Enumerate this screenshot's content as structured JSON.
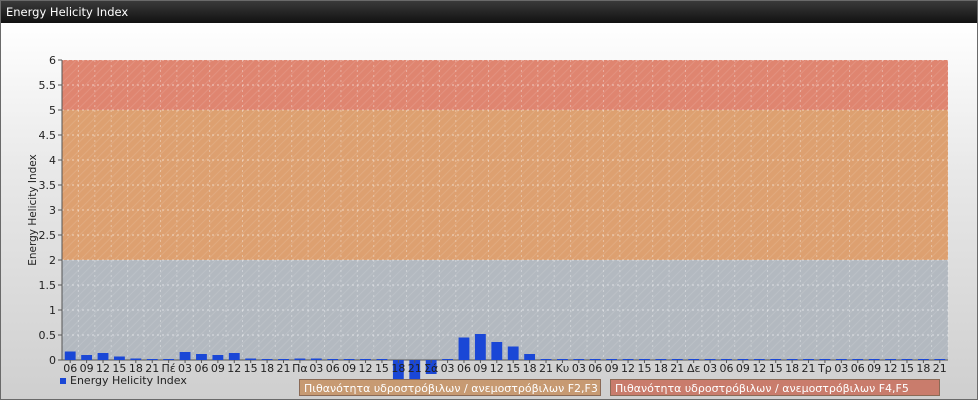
{
  "window": {
    "title": "Energy Helicity Index"
  },
  "legend": {
    "label": "Energy Helicity Index"
  },
  "bands": {
    "f23_label": "Πιθανότητα υδροστρόβιλων / ανεμοστρόβιλων F2,F3",
    "f45_label": "Πιθανότητα υδροστρόβιλων / ανεμοστρόβιλων F4,F5"
  },
  "colors": {
    "bar": "#1a47d6",
    "band_low": "#b3b9c0",
    "band_mid": "#dda070",
    "band_high": "#df8570"
  },
  "chart_data": {
    "type": "bar",
    "ylabel": "Energy Helicity Index",
    "ylim": [
      0,
      6
    ],
    "yticks": [
      "0",
      "0.5",
      "1",
      "1.5",
      "2",
      "2.5",
      "3",
      "3.5",
      "4",
      "4.5",
      "5",
      "5.5",
      "6"
    ],
    "shaded_bands": [
      {
        "from": 0,
        "to": 2,
        "color": "#b3b9c0"
      },
      {
        "from": 2,
        "to": 5,
        "color": "#dda070"
      },
      {
        "from": 5,
        "to": 6,
        "color": "#df8570"
      }
    ],
    "categories": [
      "06",
      "09",
      "12",
      "15",
      "18",
      "21",
      "Πέ",
      "03",
      "06",
      "09",
      "12",
      "15",
      "18",
      "21",
      "Πα",
      "03",
      "06",
      "09",
      "12",
      "15",
      "18",
      "21",
      "Σά",
      "03",
      "06",
      "09",
      "12",
      "15",
      "18",
      "21",
      "Κυ",
      "03",
      "06",
      "09",
      "12",
      "15",
      "18",
      "21",
      "Δε",
      "03",
      "06",
      "09",
      "12",
      "15",
      "18",
      "21",
      "Τρ",
      "03",
      "06",
      "09",
      "12",
      "15",
      "18",
      "21"
    ],
    "values": [
      0.17,
      0.1,
      0.14,
      0.07,
      0.03,
      0.02,
      0.02,
      0.16,
      0.12,
      0.1,
      0.14,
      0.03,
      0.02,
      0.02,
      0.03,
      0.03,
      0.02,
      0.02,
      0.02,
      0.02,
      -0.45,
      -0.42,
      -0.28,
      0.02,
      0.45,
      0.52,
      0.36,
      0.27,
      0.12,
      0.02,
      0.02,
      0.02,
      0.02,
      0.02,
      0.02,
      0.02,
      0.02,
      0.02,
      0.02,
      0.02,
      0.02,
      0.02,
      0.02,
      0.02,
      0.02,
      0.02,
      0.02,
      0.02,
      0.02,
      0.02,
      0.02,
      0.02,
      0.02,
      0.02
    ]
  }
}
